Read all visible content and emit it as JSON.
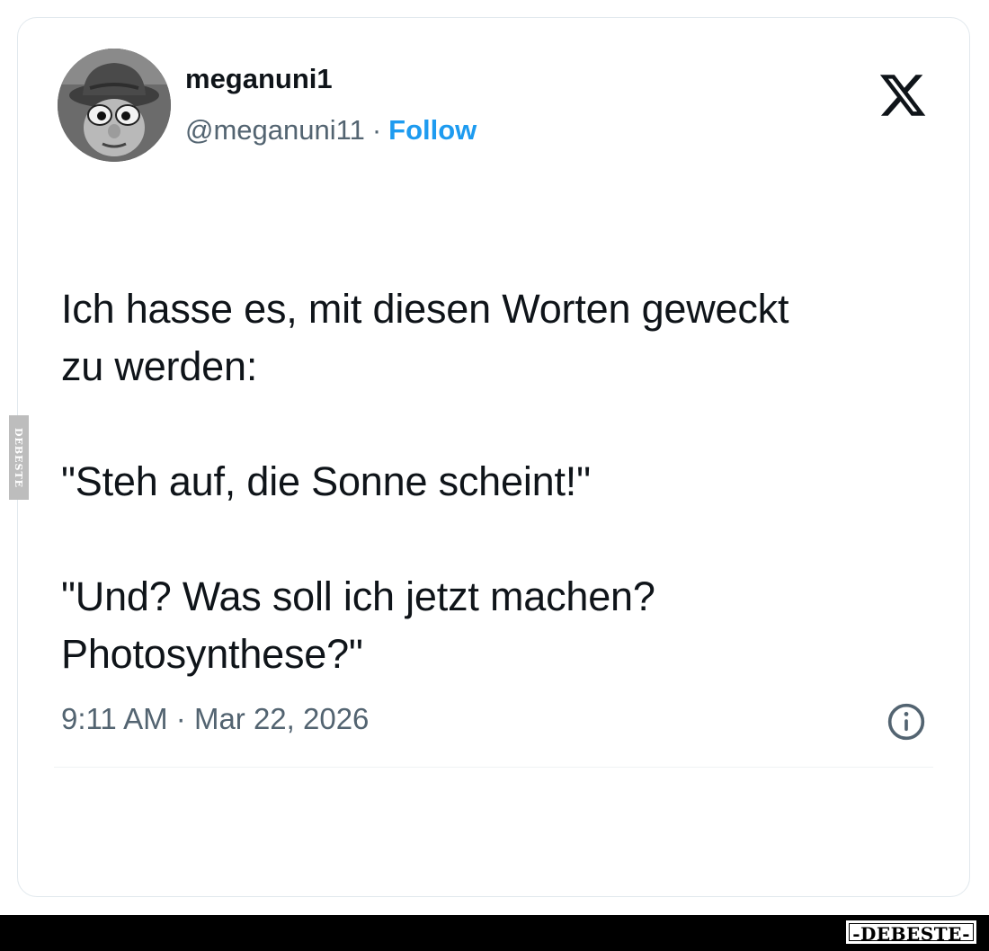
{
  "tweet": {
    "display_name": "meganuni1",
    "handle": "@meganuni11",
    "separator": "·",
    "follow_label": "Follow",
    "avatar_icon": "cartoon-character-avatar",
    "brand_icon": "x-logo-icon",
    "text": "Ich hasse es, mit diesen Worten geweckt\nzu werden:\n\n\"Steh auf, die Sonne scheint!\"\n\n\"Und? Was soll ich jetzt machen?\nPhotosynthese?\"",
    "timestamp": "9:11 AM · Mar 22, 2026",
    "info_icon": "info-icon"
  },
  "watermarks": {
    "side_text": "DEBESTE",
    "bottom_text": "-DEBESTE-"
  },
  "colors": {
    "text": "#0f1419",
    "secondary_text": "#536471",
    "accent": "#1d9bf0",
    "card_border": "#e1e8ed",
    "bottom_bar": "#000000"
  }
}
